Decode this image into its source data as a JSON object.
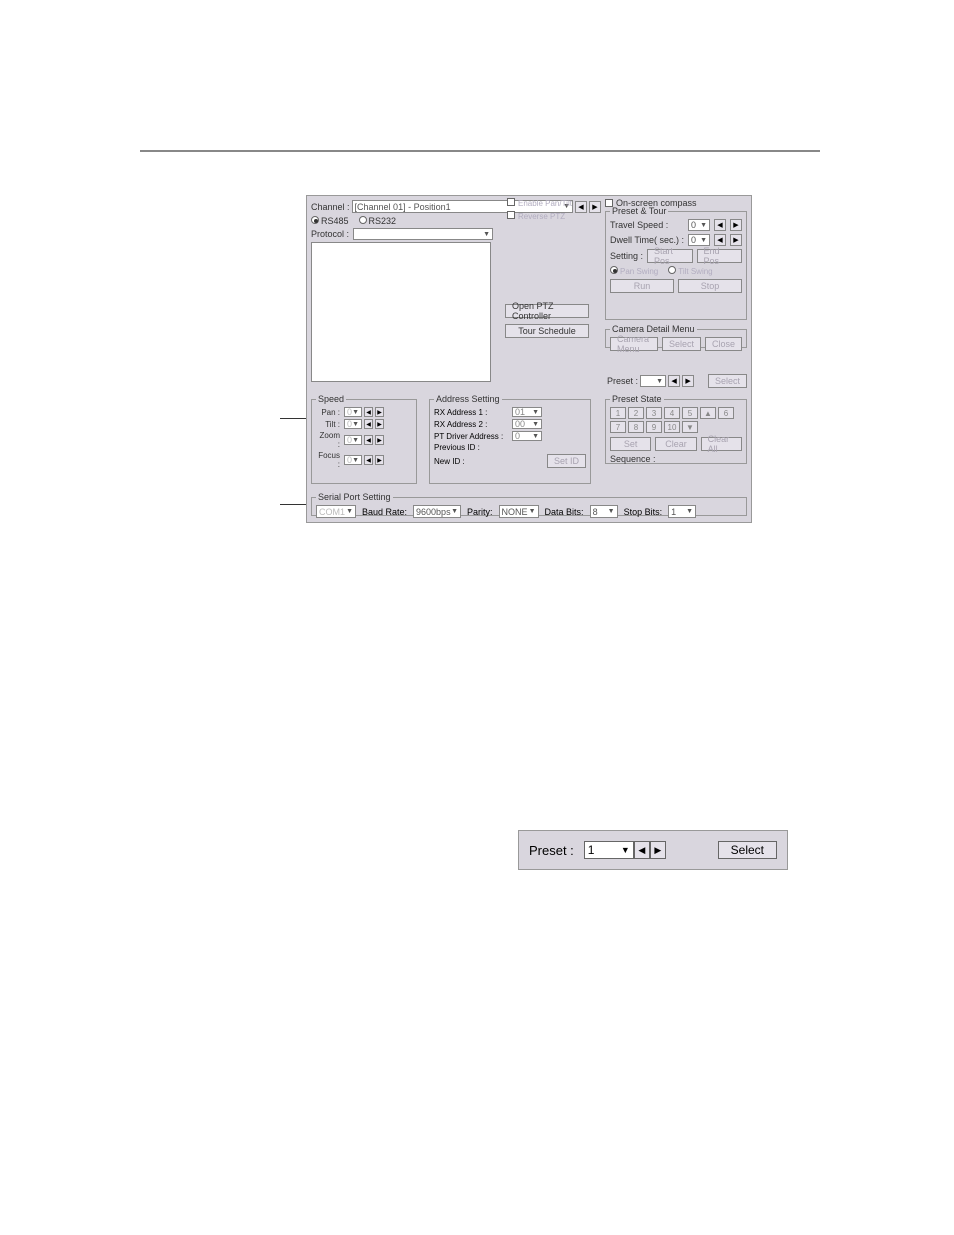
{
  "channel": {
    "label": "Channel :",
    "value": "[Channel 01] - Position1"
  },
  "comm": {
    "rs485": "RS485",
    "rs232": "RS232"
  },
  "protocol_label": "Protocol :",
  "checkboxes": {
    "enable_pantilt": "Enable Pan/Tilt",
    "reverse_ptz": "Reverse PTZ",
    "on_screen_compass": "On-screen compass"
  },
  "mid_buttons": {
    "open_ptz": "Open PTZ Controller",
    "tour_schedule": "Tour Schedule"
  },
  "preset_tour": {
    "legend": "Preset & Tour",
    "travel_speed": "Travel Speed :",
    "dwell_time": "Dwell Time( sec.) :",
    "setting": "Setting :",
    "start_pos": "Start Pos",
    "end_pos": "End Pos",
    "pan_swing": "Pan Swing",
    "tilt_swing": "Tilt Swing",
    "run": "Run",
    "stop": "Stop"
  },
  "camera_menu": {
    "legend": "Camera Detail Menu",
    "camera_menu_btn": "Camera Menu",
    "select_btn": "Select",
    "close_btn": "Close"
  },
  "preset_row": {
    "label": "Preset :",
    "value": "",
    "select": "Select"
  },
  "preset_state": {
    "legend": "Preset State",
    "nums": [
      "1",
      "2",
      "3",
      "4",
      "5",
      "6",
      "7",
      "8",
      "9",
      "10"
    ],
    "set": "Set",
    "clear": "Clear",
    "clear_all": "Clear All",
    "sequence": "Sequence :"
  },
  "speed": {
    "legend": "Speed",
    "pan": "Pan :",
    "tilt": "Tilt :",
    "zoom": "Zoom :",
    "focus": "Focus :",
    "val": "0"
  },
  "address": {
    "legend": "Address Setting",
    "rx1": "RX Address 1 :",
    "rx1_val": "01",
    "rx2": "RX Address 2 :",
    "rx2_val": "00",
    "pt_driver": "PT Driver Address :",
    "pt_val": "0",
    "prev_id": "Previous ID :",
    "new_id": "New ID :",
    "set_id": "Set ID"
  },
  "serial": {
    "legend": "Serial Port Setting",
    "com": "COM1",
    "baud_label": "Baud Rate:",
    "baud_val": "9600bps",
    "parity_label": "Parity:",
    "parity_val": "NONE",
    "databits_label": "Data Bits:",
    "databits_val": "8",
    "stopbits_label": "Stop Bits:",
    "stopbits_val": "1"
  },
  "panel2": {
    "label": "Preset :",
    "value": "1",
    "select": "Select"
  }
}
